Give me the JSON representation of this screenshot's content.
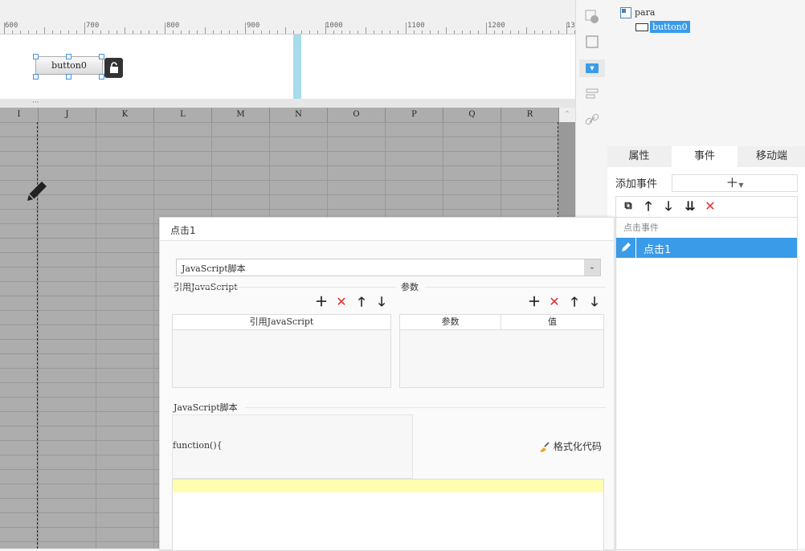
{
  "ruler": {
    "labels": [
      "600",
      "700",
      "800",
      "900",
      "1000",
      "1100",
      "1200",
      "13"
    ]
  },
  "design": {
    "button_label": "button0"
  },
  "grid": {
    "columns": [
      "I",
      "J",
      "K",
      "L",
      "M",
      "N",
      "O",
      "P",
      "Q",
      "R"
    ]
  },
  "tree": {
    "root": "para",
    "child": "button0"
  },
  "tabs": {
    "properties": "属性",
    "events": "事件",
    "mobile": "移动端"
  },
  "events_panel": {
    "add_event_label": "添加事件",
    "section_label": "点击事件",
    "selected_event": "点击1"
  },
  "dialog": {
    "title": "点击1",
    "script_type": "JavaScript脚本",
    "ref_js_label": "引用JavaScript",
    "params_label": "参数",
    "ref_js_col": "引用JavaScript",
    "param_col": "参数",
    "value_col": "值",
    "script_section": "JavaScript脚本",
    "function_text": "function(){",
    "format_code": "格式化代码"
  }
}
